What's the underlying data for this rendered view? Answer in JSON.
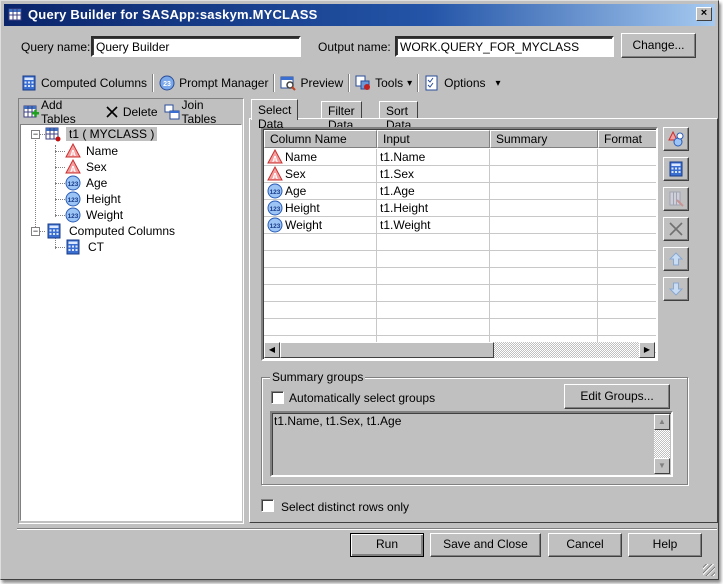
{
  "window": {
    "title": "Query Builder for SASApp:saskym.MYCLASS",
    "close_label": "×"
  },
  "header": {
    "query_name_label": "Query name:",
    "query_name_value": "Query Builder",
    "output_name_label": "Output name:",
    "output_name_value": "WORK.QUERY_FOR_MYCLASS",
    "change_button": "Change..."
  },
  "toolbar": {
    "computed_columns": "Computed Columns",
    "prompt_manager": "Prompt Manager",
    "preview": "Preview",
    "tools": "Tools",
    "options": "Options",
    "dropdown_glyph": "▾"
  },
  "left_panel": {
    "add_tables": "Add Tables",
    "delete": "Delete",
    "join_tables": "Join Tables",
    "tree": {
      "table_node": "t1 ( MYCLASS )",
      "columns": [
        {
          "name": "Name",
          "type": "character"
        },
        {
          "name": "Sex",
          "type": "character"
        },
        {
          "name": "Age",
          "type": "numeric"
        },
        {
          "name": "Height",
          "type": "numeric"
        },
        {
          "name": "Weight",
          "type": "numeric"
        }
      ],
      "computed_node": "Computed Columns",
      "computed_children": [
        "CT"
      ]
    }
  },
  "tabs": [
    {
      "label": "Select Data",
      "active": true
    },
    {
      "label": "Filter Data",
      "active": false
    },
    {
      "label": "Sort Data",
      "active": false
    }
  ],
  "select_data": {
    "columns": [
      "Column Name",
      "Input",
      "Summary",
      "Format"
    ],
    "rows": [
      {
        "name": "Name",
        "type": "character",
        "input": "t1.Name",
        "summary": "",
        "format": ""
      },
      {
        "name": "Sex",
        "type": "character",
        "input": "t1.Sex",
        "summary": "",
        "format": ""
      },
      {
        "name": "Age",
        "type": "numeric",
        "input": "t1.Age",
        "summary": "",
        "format": ""
      },
      {
        "name": "Height",
        "type": "numeric",
        "input": "t1.Height",
        "summary": "",
        "format": ""
      },
      {
        "name": "Weight",
        "type": "numeric",
        "input": "t1.Weight",
        "summary": "",
        "format": ""
      }
    ],
    "side_buttons": [
      "select-columns",
      "computed-column",
      "edit-column",
      "delete-column",
      "move-up",
      "move-down"
    ]
  },
  "summary_groups": {
    "legend": "Summary groups",
    "auto_select_label": "Automatically select groups",
    "auto_select_checked": false,
    "edit_groups_button": "Edit Groups...",
    "groups_value": "t1.Name, t1.Sex, t1.Age"
  },
  "distinct": {
    "label": "Select distinct rows only",
    "checked": false
  },
  "footer": {
    "run": "Run",
    "save_and_close": "Save and Close",
    "cancel": "Cancel",
    "help": "Help"
  },
  "colors": {
    "title_start": "#0a246a",
    "title_end": "#a6caf0",
    "face": "#c0c0c0",
    "char_icon": "#e05050",
    "num_icon": "#3a78d8"
  }
}
